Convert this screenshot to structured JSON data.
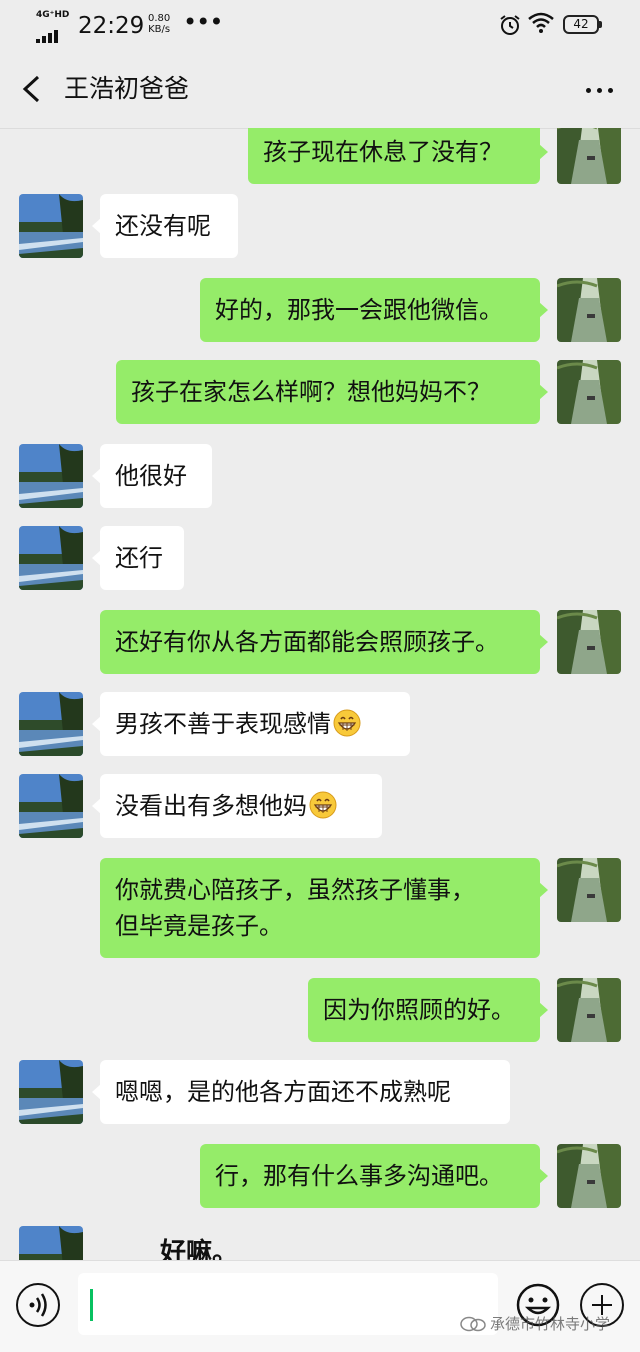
{
  "status_bar": {
    "network": "4G⁺HD",
    "time": "22:29",
    "speed_value": "0.80",
    "speed_unit": "KB/s",
    "battery": "42"
  },
  "header": {
    "title": "王浩初爸爸"
  },
  "colors": {
    "background": "#ededed",
    "sent_bubble": "#95ec69",
    "received_bubble": "#ffffff",
    "caret": "#07c160"
  },
  "messages": [
    {
      "side": "right",
      "text": "孩子现在休息了没有？"
    },
    {
      "side": "left",
      "text": "还没有呢"
    },
    {
      "side": "right",
      "text": "好的，那我一会跟他微信。"
    },
    {
      "side": "right",
      "text": "孩子在家怎么样啊？想他妈妈不？"
    },
    {
      "side": "left",
      "text": "他很好"
    },
    {
      "side": "left",
      "text": "还行"
    },
    {
      "side": "right",
      "text": "还好有你从各方面都能会照顾孩子。"
    },
    {
      "side": "left",
      "text": "男孩不善于表现感情",
      "emoji": "grinning-face-emoji"
    },
    {
      "side": "left",
      "text": "没看出有多想他妈",
      "emoji": "grinning-face-emoji"
    },
    {
      "side": "right",
      "line1": "你就费心陪孩子，虽然孩子懂事，",
      "line2": "但毕竟是孩子。"
    },
    {
      "side": "right",
      "text": "因为你照顾的好。"
    },
    {
      "side": "left",
      "text": "嗯嗯，是的他各方面还不成熟呢"
    },
    {
      "side": "right",
      "text": "行，那有什么事多沟通吧。"
    },
    {
      "side": "left",
      "text": "好嘛。"
    }
  ],
  "input_bar": {
    "value": "",
    "watermark": "承德市竹林寺小学"
  }
}
